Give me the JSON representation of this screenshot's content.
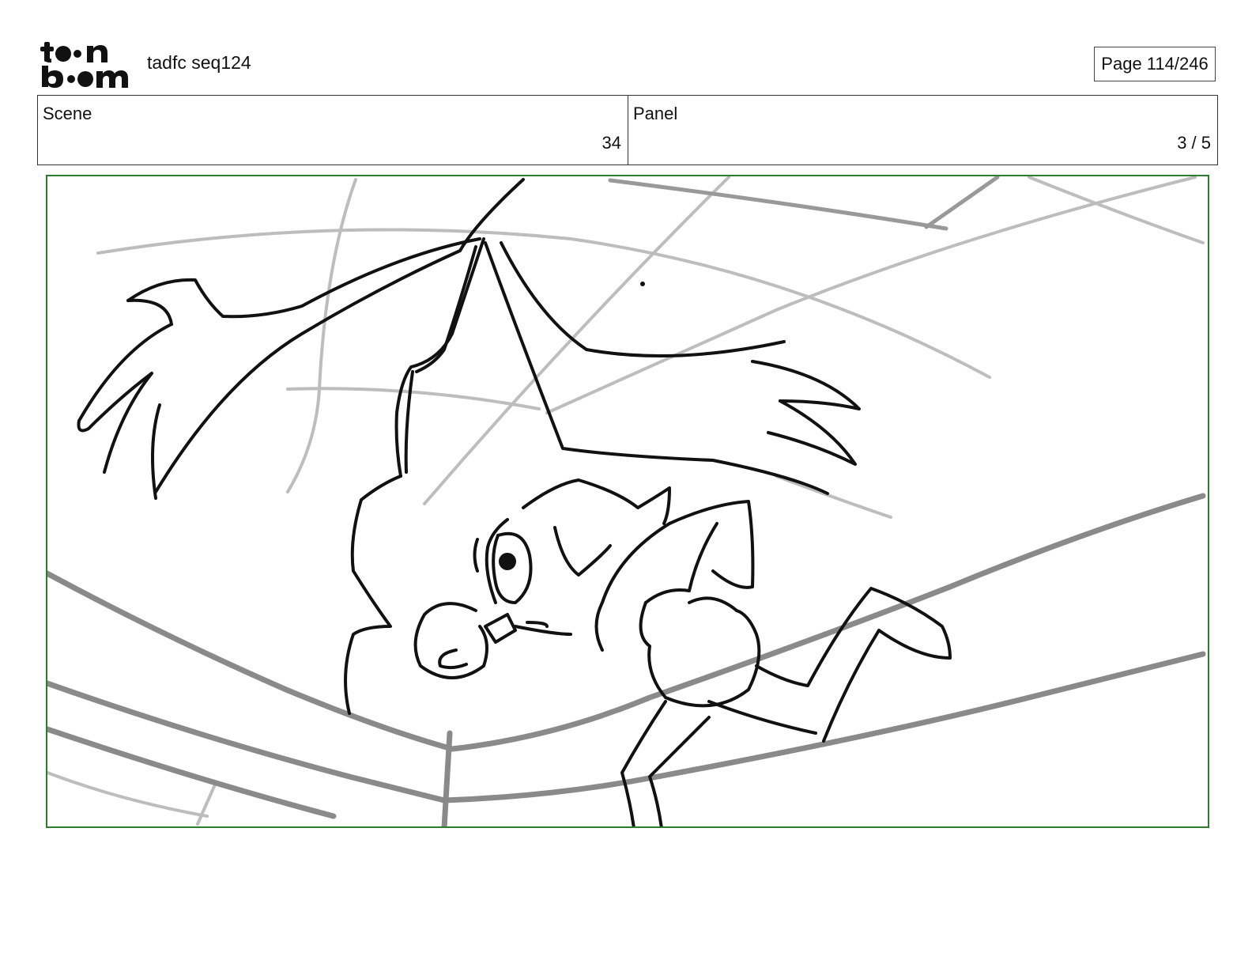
{
  "header": {
    "logo_text": "toon boom",
    "document_title": "tadfc seq124",
    "page_indicator": "Page 114/246"
  },
  "info": {
    "scene_label": "Scene",
    "scene_value": "34",
    "panel_label": "Panel",
    "panel_value": "3 / 5"
  },
  "panel_frame": {
    "border_color": "#2e7d2e",
    "content": "storyboard-sketch"
  }
}
